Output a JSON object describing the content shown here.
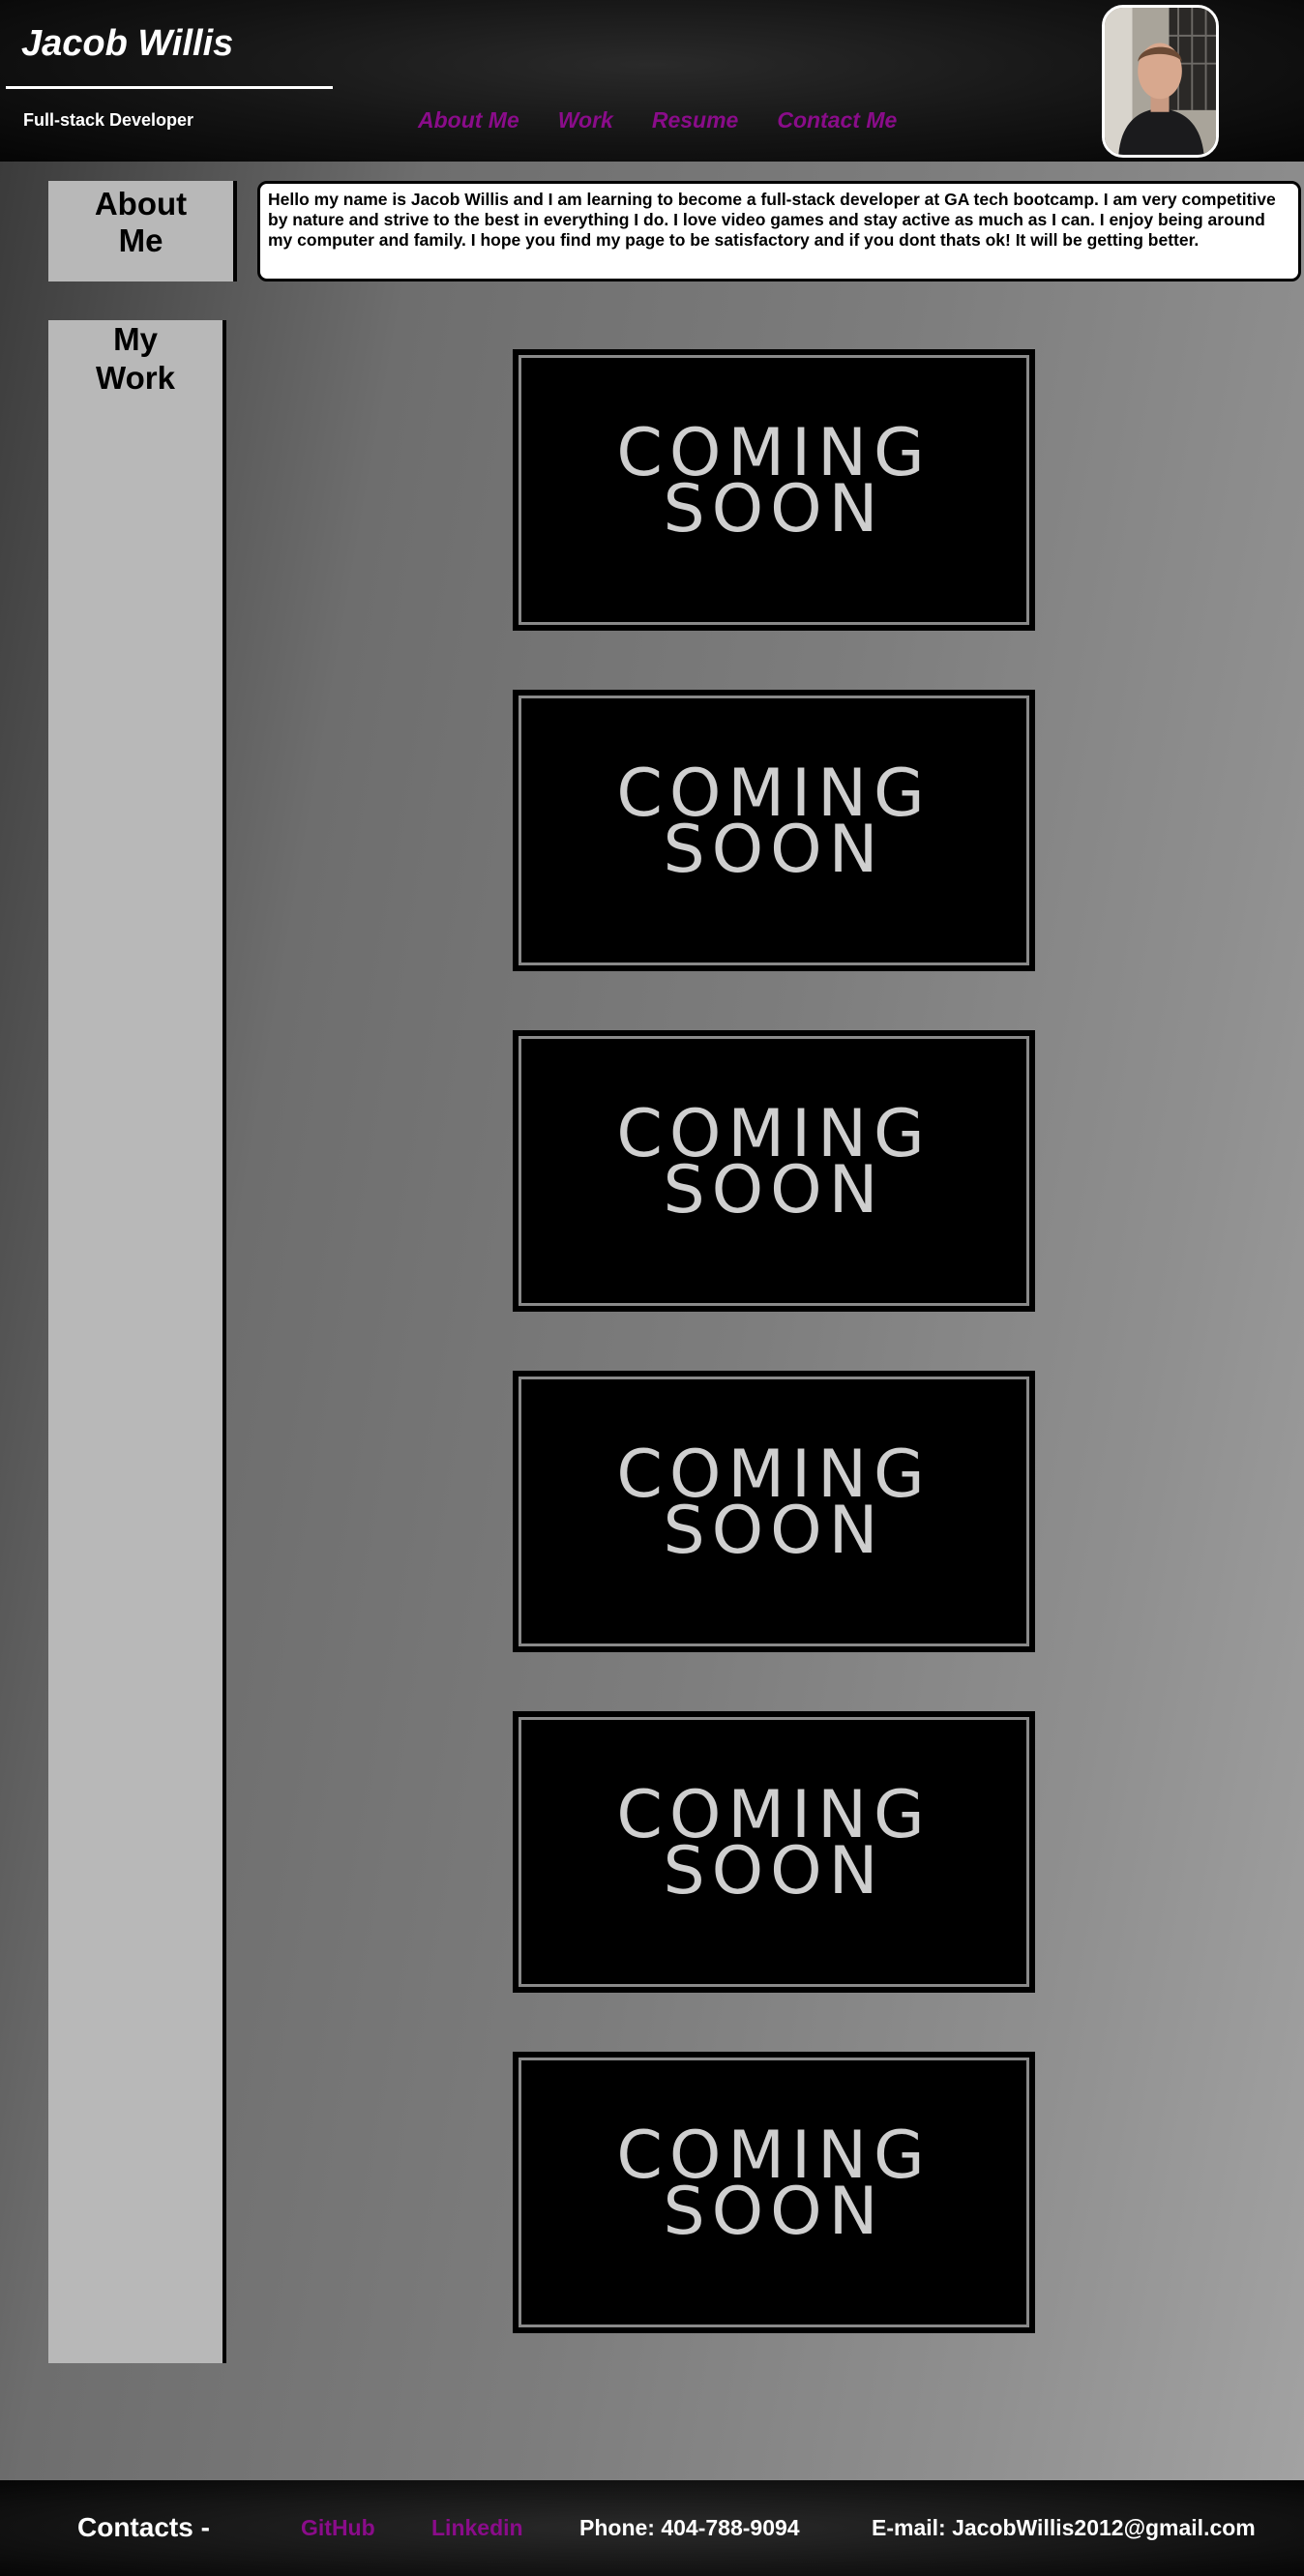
{
  "header": {
    "name": "Jacob Willis",
    "role": "Full-stack Developer",
    "nav": [
      "About Me",
      "Work",
      "Resume",
      "Contact Me"
    ]
  },
  "about": {
    "title": "About Me",
    "text": "Hello my name is Jacob Willis and I am learning to become a full-stack developer at GA tech bootcamp. I am very competitive by nature and strive to the best in everything I do. I love video games and stay active as much as I can. I enjoy being around my computer and family. I hope you find my page to be satisfactory and if you dont thats ok! It will be getting better."
  },
  "work": {
    "title": "My Work",
    "cards": [
      {
        "line1": "COMING",
        "line2": "SOON"
      },
      {
        "line1": "COMING",
        "line2": "SOON"
      },
      {
        "line1": "COMING",
        "line2": "SOON"
      },
      {
        "line1": "COMING",
        "line2": "SOON"
      },
      {
        "line1": "COMING",
        "line2": "SOON"
      },
      {
        "line1": "COMING",
        "line2": "SOON"
      }
    ]
  },
  "footer": {
    "label": "Contacts -",
    "github": "GitHub",
    "linkedin": "Linkedin",
    "phone": "Phone: 404-788-9094",
    "email": "E-mail: JacobWillis2012@gmail.com"
  },
  "colors": {
    "accent": "#8a0c8a",
    "panel": "#b8b8b8"
  }
}
